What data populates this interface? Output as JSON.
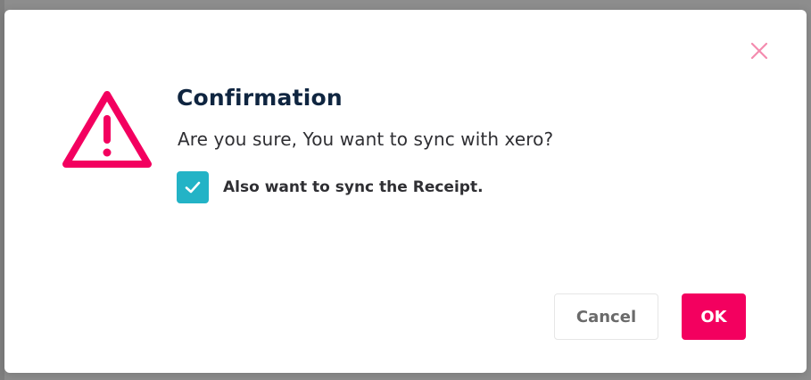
{
  "dialog": {
    "title": "Confirmation",
    "message": "Are you sure, You want to sync with xero?",
    "checkbox": {
      "label": "Also want to sync the Receipt.",
      "checked": true
    },
    "buttons": {
      "cancel_label": "Cancel",
      "ok_label": "OK"
    },
    "icons": {
      "warning": "warning-triangle-icon",
      "close": "close-icon",
      "check": "checkmark-icon"
    }
  },
  "colors": {
    "accent": "#f3005f",
    "checkbox": "#23b3c6",
    "title": "#0f2540",
    "close_icon": "#f48bae",
    "overlay": "#8d8d8d"
  }
}
